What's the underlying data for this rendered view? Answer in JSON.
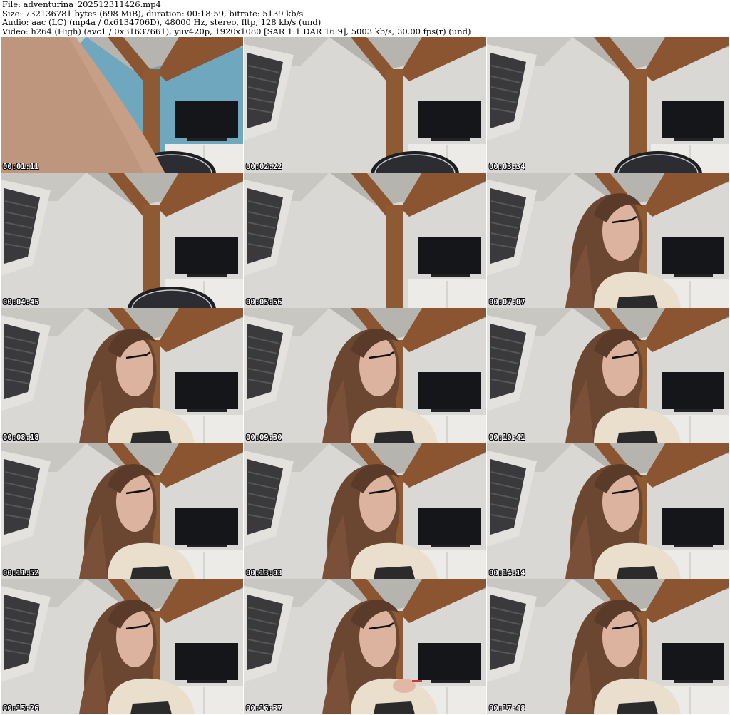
{
  "header": {
    "file_line": "File: adventurina_202512311426.mp4",
    "size_line": "Size: 732136781 bytes (698 MiB), duration: 00:18:59, bitrate: 5139 kb/s",
    "audio_line": "Audio: aac (LC) (mp4a / 0x6134706D), 48000 Hz, stereo, fltp, 128 kb/s (und)",
    "video_line": "Video: h264 (High) (avc1 / 0x31637661), yuv420p, 1920x1080 [SAR 1:1 DAR 16:9], 5003 kb/s, 30.00 fps(r) (und)"
  },
  "thumbnails": [
    {
      "timestamp": "00:01:11",
      "scene": "closeup-skin"
    },
    {
      "timestamp": "00:02:22",
      "scene": "room-chair"
    },
    {
      "timestamp": "00:03:34",
      "scene": "room-chair"
    },
    {
      "timestamp": "00:04:45",
      "scene": "room-chair"
    },
    {
      "timestamp": "00:05:56",
      "scene": "room-empty"
    },
    {
      "timestamp": "00:07:07",
      "scene": "person"
    },
    {
      "timestamp": "00:08:18",
      "scene": "person"
    },
    {
      "timestamp": "00:09:30",
      "scene": "person"
    },
    {
      "timestamp": "00:10:41",
      "scene": "person"
    },
    {
      "timestamp": "00:11:52",
      "scene": "person"
    },
    {
      "timestamp": "00:13:03",
      "scene": "person"
    },
    {
      "timestamp": "00:14:14",
      "scene": "person"
    },
    {
      "timestamp": "00:15:26",
      "scene": "person"
    },
    {
      "timestamp": "00:16:37",
      "scene": "person-hand"
    },
    {
      "timestamp": "00:17:48",
      "scene": "person"
    }
  ]
}
